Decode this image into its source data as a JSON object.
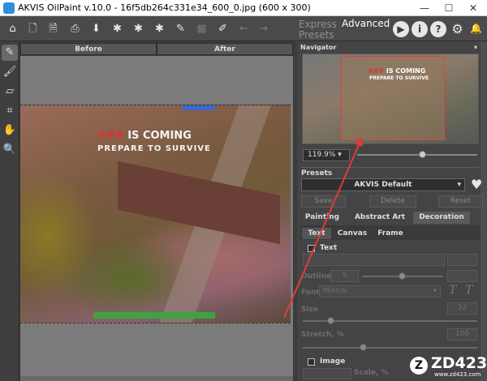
{
  "window": {
    "title": "AKVIS OilPaint v.10.0 - 16f5db264c331e34_600_0.jpg (600 x 300)",
    "min": "—",
    "max": "☐",
    "close": "✕"
  },
  "toolbar": {
    "icons": [
      "home-icon",
      "open-file-icon",
      "save-file-icon",
      "print-icon",
      "download-icon",
      "settings-a-icon",
      "settings-b-icon",
      "settings-c-icon",
      "wand-icon",
      "disabled-icon",
      "brush-icon",
      "undo-icon",
      "redo-icon"
    ],
    "mode_express": "Express Presets",
    "mode_advanced": "Advanced",
    "run_icon": "▶",
    "info_icon": "i",
    "help_icon": "?",
    "settings_icon": "⚙",
    "bell_icon": "🔔"
  },
  "view_tabs": {
    "before": "Before",
    "after": "After"
  },
  "image_caption": {
    "line1_red": "###",
    "line1": "IS COMING",
    "line2": "PREPARE TO SURVIVE"
  },
  "navigator": {
    "label": "Navigator",
    "zoom": "119.9%",
    "zoom_slider": 0.55
  },
  "presets": {
    "label": "Presets",
    "selected": "AKVIS Default",
    "save": "Save",
    "delete": "Delete",
    "reset": "Reset"
  },
  "tabs": {
    "painting": "Painting",
    "abstract_art": "Abstract Art",
    "decoration": "Decoration"
  },
  "subtabs": {
    "text": "Text",
    "canvas": "Canvas",
    "frame": "Frame"
  },
  "decoration": {
    "text_checkbox": "Text",
    "outline_label": "Outline",
    "outline_value": "5",
    "font_label": "Font",
    "font_value": "Mistral",
    "size_label": "Size",
    "size_value": "32",
    "stretch_label": "Stretch, %",
    "stretch_value": "100",
    "image_checkbox": "Image",
    "scale_label": "Scale, %"
  },
  "watermark": {
    "logo": "Z",
    "brand": "ZD423",
    "url": "www.zd423.com"
  }
}
